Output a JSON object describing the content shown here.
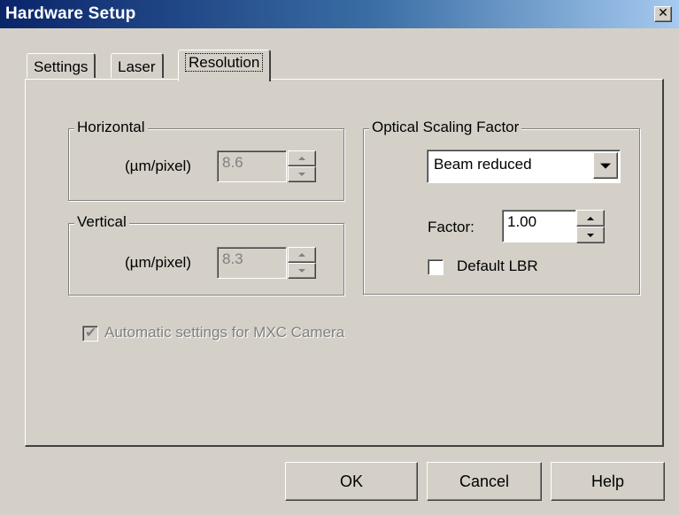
{
  "window": {
    "title": "Hardware Setup",
    "close_glyph": "✕"
  },
  "tabs": [
    {
      "label": "Settings",
      "active": false
    },
    {
      "label": "Laser",
      "active": false
    },
    {
      "label": "Resolution",
      "active": true
    }
  ],
  "horizontal": {
    "legend": "Horizontal",
    "unit_label": "(µm/pixel)",
    "value": "8.6",
    "enabled": false
  },
  "vertical": {
    "legend": "Vertical",
    "unit_label": "(µm/pixel)",
    "value": "8.3",
    "enabled": false
  },
  "optical": {
    "legend": "Optical Scaling Factor",
    "mode_selected": "Beam reduced",
    "factor_label": "Factor:",
    "factor_value": "1.00",
    "default_lbr_label": "Default LBR",
    "default_lbr_checked": false
  },
  "auto_mxc": {
    "label": "Automatic settings for MXC Camera",
    "checked": true,
    "enabled": false
  },
  "buttons": {
    "ok": "OK",
    "cancel": "Cancel",
    "help": "Help"
  },
  "icons": {
    "close": "close-icon",
    "checkmark": "checkmark-icon",
    "spin_up": "chevron-up-icon",
    "spin_down": "chevron-down-icon",
    "dropdown": "dropdown-arrow-icon"
  },
  "colors": {
    "dialog_bg": "#d4d0c8",
    "title_start": "#0a246a",
    "title_end": "#a6caf0",
    "disabled_text": "#808080"
  }
}
